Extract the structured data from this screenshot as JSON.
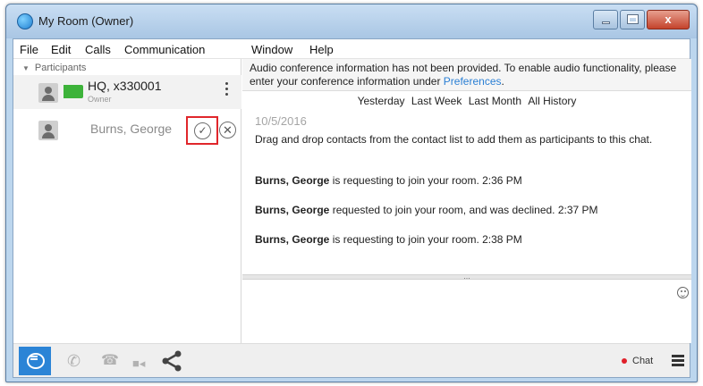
{
  "window": {
    "title": "My Room (Owner)",
    "controls": {
      "minimize": "minimize",
      "maximize": "maximize",
      "close": "x"
    }
  },
  "menu": [
    "File",
    "Edit",
    "Calls",
    "Communication",
    "Window",
    "Help"
  ],
  "participants": {
    "header": "Participants",
    "list": [
      {
        "name": "HQ, x330001",
        "role": "Owner",
        "status_color": "#3db33a"
      },
      {
        "name": "Burns, George",
        "pending": true
      }
    ]
  },
  "chat": {
    "banner_text": "Audio conference information has not been provided. To enable audio functionality, please enter your conference information under ",
    "banner_link": "Preferences",
    "banner_end": ".",
    "history": [
      "Yesterday",
      "Last Week",
      "Last Month",
      "All History"
    ],
    "date": "10/5/2016",
    "messages": [
      {
        "bold": "",
        "text": "Drag and drop contacts from the contact list to add them as participants to this chat."
      },
      {
        "bold": "Burns, George",
        "text": " is requesting to join your room. 2:36 PM"
      },
      {
        "bold": "Burns, George",
        "text": " requested to join your room, and was declined. 2:37 PM"
      },
      {
        "bold": "Burns, George",
        "text": " is requesting to join your room. 2:38 PM"
      }
    ],
    "splitter": "..."
  },
  "toolbar": {
    "status_label": "Chat",
    "status_color": "#e0202a",
    "icons": [
      "chat-icon",
      "phone-icon",
      "deskphone-icon",
      "video-icon",
      "share-icon",
      "hamburger-icon"
    ]
  }
}
